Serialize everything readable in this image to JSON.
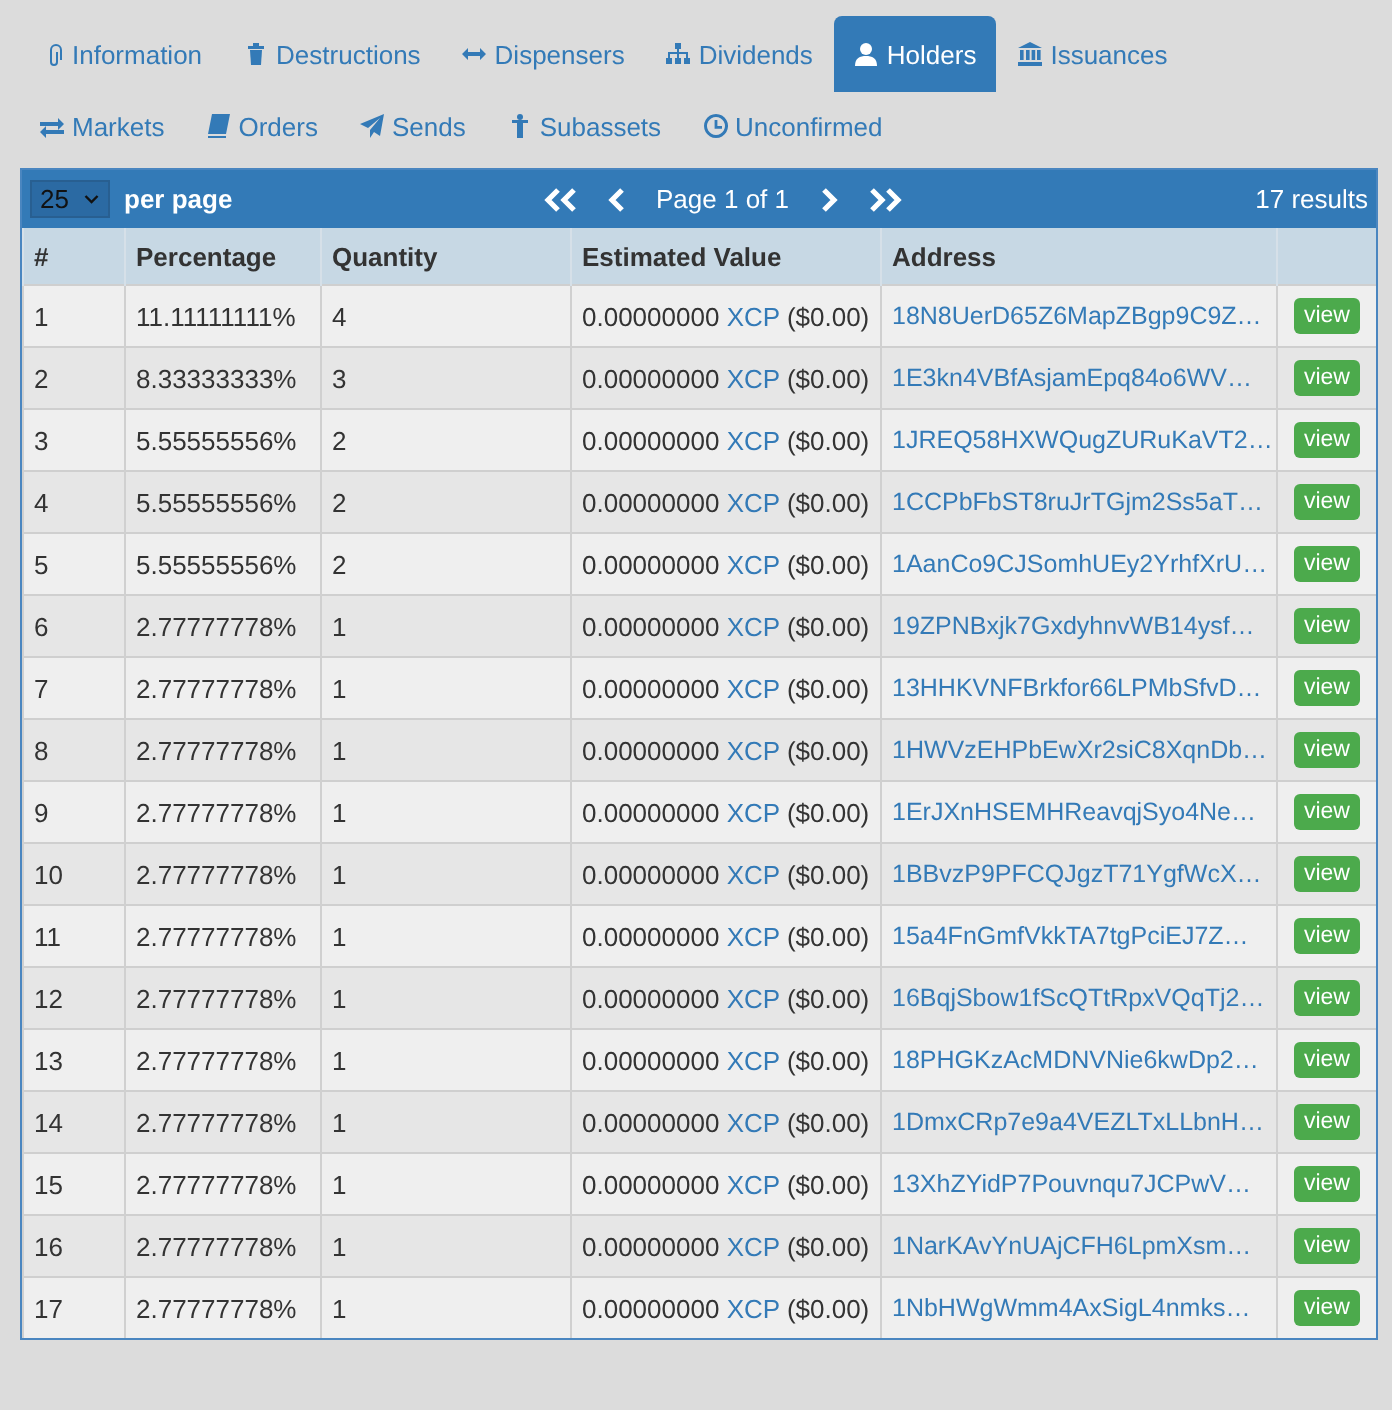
{
  "tabs": [
    {
      "label": "Information",
      "selected": false
    },
    {
      "label": "Destructions",
      "selected": false
    },
    {
      "label": "Dispensers",
      "selected": false
    },
    {
      "label": "Dividends",
      "selected": false
    },
    {
      "label": "Holders",
      "selected": true
    },
    {
      "label": "Issuances",
      "selected": false
    },
    {
      "label": "Markets",
      "selected": false
    },
    {
      "label": "Orders",
      "selected": false
    },
    {
      "label": "Sends",
      "selected": false
    },
    {
      "label": "Subassets",
      "selected": false
    },
    {
      "label": "Unconfirmed",
      "selected": false
    }
  ],
  "pager": {
    "per_page": "25",
    "per_page_label": "per page",
    "page": "Page 1 of 1",
    "results": "17 results"
  },
  "table": {
    "columns": [
      "#",
      "Percentage",
      "Quantity",
      "Estimated Value",
      "Address"
    ],
    "rows": [
      {
        "n": "1",
        "percentage": "11.11111111%",
        "quantity": "4",
        "value": "0.00000000",
        "asset": "XCP",
        "usd": "($0.00)",
        "address": "18N8UerD65Z6MapZBgp9C9Z…",
        "action": "view"
      },
      {
        "n": "2",
        "percentage": "8.33333333%",
        "quantity": "3",
        "value": "0.00000000",
        "asset": "XCP",
        "usd": "($0.00)",
        "address": "1E3kn4VBfAsjamEpq84o6WV…",
        "action": "view"
      },
      {
        "n": "3",
        "percentage": "5.55555556%",
        "quantity": "2",
        "value": "0.00000000",
        "asset": "XCP",
        "usd": "($0.00)",
        "address": "1JREQ58HXWQugZURuKaVT2…",
        "action": "view"
      },
      {
        "n": "4",
        "percentage": "5.55555556%",
        "quantity": "2",
        "value": "0.00000000",
        "asset": "XCP",
        "usd": "($0.00)",
        "address": "1CCPbFbST8ruJrTGjm2Ss5aT…",
        "action": "view"
      },
      {
        "n": "5",
        "percentage": "5.55555556%",
        "quantity": "2",
        "value": "0.00000000",
        "asset": "XCP",
        "usd": "($0.00)",
        "address": "1AanCo9CJSomhUEy2YrhfXrU…",
        "action": "view"
      },
      {
        "n": "6",
        "percentage": "2.77777778%",
        "quantity": "1",
        "value": "0.00000000",
        "asset": "XCP",
        "usd": "($0.00)",
        "address": "19ZPNBxjk7GxdyhnvWB14ysf…",
        "action": "view"
      },
      {
        "n": "7",
        "percentage": "2.77777778%",
        "quantity": "1",
        "value": "0.00000000",
        "asset": "XCP",
        "usd": "($0.00)",
        "address": "13HHKVNFBrkfor66LPMbSfvD…",
        "action": "view"
      },
      {
        "n": "8",
        "percentage": "2.77777778%",
        "quantity": "1",
        "value": "0.00000000",
        "asset": "XCP",
        "usd": "($0.00)",
        "address": "1HWVzEHPbEwXr2siC8XqnDb…",
        "action": "view"
      },
      {
        "n": "9",
        "percentage": "2.77777778%",
        "quantity": "1",
        "value": "0.00000000",
        "asset": "XCP",
        "usd": "($0.00)",
        "address": "1ErJXnHSEMHReavqjSyo4Ne…",
        "action": "view"
      },
      {
        "n": "10",
        "percentage": "2.77777778%",
        "quantity": "1",
        "value": "0.00000000",
        "asset": "XCP",
        "usd": "($0.00)",
        "address": "1BBvzP9PFCQJgzT71YgfWcX…",
        "action": "view"
      },
      {
        "n": "11",
        "percentage": "2.77777778%",
        "quantity": "1",
        "value": "0.00000000",
        "asset": "XCP",
        "usd": "($0.00)",
        "address": "15a4FnGmfVkkTA7tgPciEJ7Z…",
        "action": "view"
      },
      {
        "n": "12",
        "percentage": "2.77777778%",
        "quantity": "1",
        "value": "0.00000000",
        "asset": "XCP",
        "usd": "($0.00)",
        "address": "16BqjSbow1fScQTtRpxVQqTj2…",
        "action": "view"
      },
      {
        "n": "13",
        "percentage": "2.77777778%",
        "quantity": "1",
        "value": "0.00000000",
        "asset": "XCP",
        "usd": "($0.00)",
        "address": "18PHGKzAcMDNVNie6kwDp2…",
        "action": "view"
      },
      {
        "n": "14",
        "percentage": "2.77777778%",
        "quantity": "1",
        "value": "0.00000000",
        "asset": "XCP",
        "usd": "($0.00)",
        "address": "1DmxCRp7e9a4VEZLTxLLbnH…",
        "action": "view"
      },
      {
        "n": "15",
        "percentage": "2.77777778%",
        "quantity": "1",
        "value": "0.00000000",
        "asset": "XCP",
        "usd": "($0.00)",
        "address": "13XhZYidP7Pouvnqu7JCPwV…",
        "action": "view"
      },
      {
        "n": "16",
        "percentage": "2.77777778%",
        "quantity": "1",
        "value": "0.00000000",
        "asset": "XCP",
        "usd": "($0.00)",
        "address": "1NarKAvYnUAjCFH6LpmXsm…",
        "action": "view"
      },
      {
        "n": "17",
        "percentage": "2.77777778%",
        "quantity": "1",
        "value": "0.00000000",
        "asset": "XCP",
        "usd": "($0.00)",
        "address": "1NbHWgWmm4AxSigL4nmks…",
        "action": "view"
      }
    ]
  }
}
